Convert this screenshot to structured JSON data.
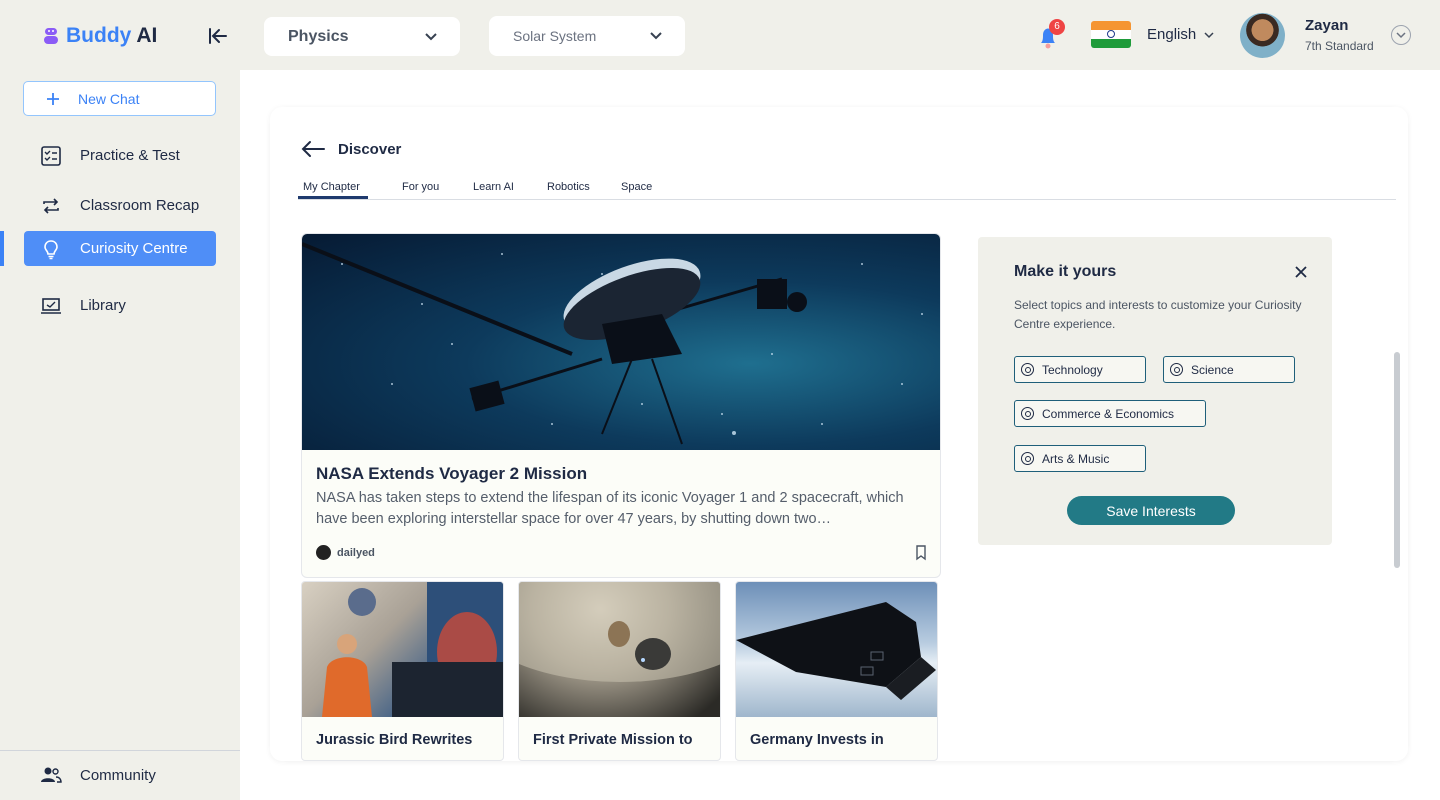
{
  "brand": {
    "buddy": "Buddy",
    "ai": "AI"
  },
  "header": {
    "subject": "Physics",
    "chapter": "Solar System",
    "notifications": "6",
    "language": "English",
    "user_name": "Zayan",
    "user_grade": "7th Standard"
  },
  "sidebar": {
    "new_chat": "New Chat",
    "items": [
      {
        "label": "Practice & Test",
        "icon": "checklist-icon"
      },
      {
        "label": "Classroom Recap",
        "icon": "repeat-icon"
      },
      {
        "label": "Curiosity Centre",
        "icon": "lightbulb-icon",
        "active": true
      },
      {
        "label": "Library",
        "icon": "laptop-icon"
      }
    ],
    "community": "Community"
  },
  "discover": {
    "title": "Discover",
    "tabs": [
      {
        "label": "My Chapter",
        "active": true
      },
      {
        "label": "For you"
      },
      {
        "label": "Learn AI"
      },
      {
        "label": "Robotics"
      },
      {
        "label": "Space"
      }
    ],
    "hero": {
      "title": "NASA Extends Voyager 2 Mission",
      "description": "NASA has taken steps to extend the lifespan of its iconic Voyager 1 and 2 spacecraft, which have been exploring interstellar space for over 47 years, by shutting down two…",
      "source": "dailyed"
    },
    "cards": [
      {
        "title": "Jurassic Bird Rewrites"
      },
      {
        "title": "First Private Mission to"
      },
      {
        "title": "Germany Invests in"
      }
    ]
  },
  "prefs": {
    "title": "Make it yours",
    "description": "Select topics and interests to customize your Curiosity Centre experience.",
    "chips": [
      "Technology",
      "Science",
      "Commerce & Economics",
      "Arts & Music"
    ],
    "save": "Save Interests"
  },
  "colors": {
    "accent": "#4f8ef7",
    "brand_purple": "#8b5cf6",
    "save_button": "#227a86",
    "badge": "#ef4444"
  }
}
